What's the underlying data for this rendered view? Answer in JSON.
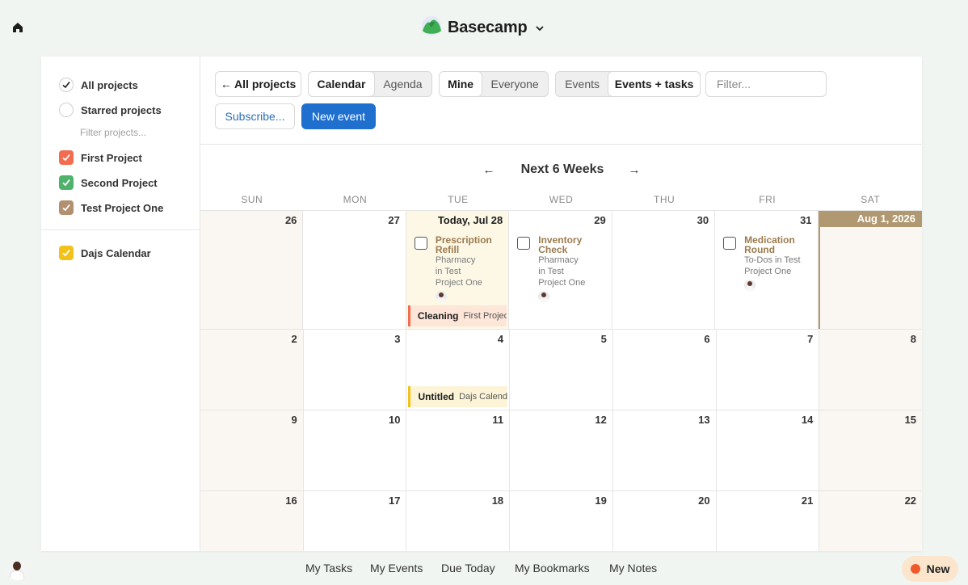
{
  "header": {
    "brand": "Basecamp"
  },
  "sidebar": {
    "items": [
      {
        "label": "All projects",
        "type": "radio",
        "checked": true
      },
      {
        "label": "Starred projects",
        "type": "radio",
        "checked": false
      }
    ],
    "filter_placeholder": "Filter projects...",
    "projects": [
      {
        "label": "First Project",
        "color": "#f26c4f",
        "checked": true
      },
      {
        "label": "Second Project",
        "color": "#4fb26c",
        "checked": true
      },
      {
        "label": "Test Project One",
        "color": "#b29070",
        "checked": true
      }
    ],
    "calendars": [
      {
        "label": "Dajs Calendar",
        "color": "#f2c21a",
        "checked": true
      }
    ]
  },
  "toolbar": {
    "all_projects": "← All projects",
    "view": {
      "options": [
        "Calendar",
        "Agenda"
      ],
      "active": "Calendar"
    },
    "scope": {
      "options": [
        "Mine",
        "Everyone"
      ],
      "active": "Mine"
    },
    "kind": {
      "options": [
        "Events",
        "Events + tasks"
      ],
      "active": "Events + tasks"
    },
    "filter_placeholder": "Filter...",
    "subscribe": "Subscribe...",
    "new_event": "New event"
  },
  "nav": {
    "prev": "←",
    "title": "Next 6 Weeks",
    "next": "→"
  },
  "calendar": {
    "days_of_week": [
      "SUN",
      "MON",
      "TUE",
      "WED",
      "THU",
      "FRI",
      "SAT"
    ],
    "today_label": "Today, Jul 28",
    "weeks": [
      [
        "26",
        "27",
        "Today, Jul 28",
        "29",
        "30",
        "31",
        "Aug 1, 2026"
      ],
      [
        "2",
        "3",
        "4",
        "5",
        "6",
        "7",
        "8"
      ],
      [
        "9",
        "10",
        "11",
        "12",
        "13",
        "14",
        "15"
      ],
      [
        "16",
        "17",
        "18",
        "19",
        "20",
        "21",
        "22"
      ]
    ],
    "todos": [
      {
        "title_1": "Prescription",
        "title_2": "Refill",
        "sub_1": "Pharmacy",
        "sub_2": "in Test",
        "sub_3": "Project One"
      },
      {
        "title_1": "Inventory",
        "title_2": "Check",
        "sub_1": "Pharmacy",
        "sub_2": "in Test",
        "sub_3": "Project One"
      },
      {
        "title_1": "Medication",
        "title_2": "Round",
        "sub_1": "To-Dos in Test",
        "sub_2": "Project One"
      }
    ],
    "events": [
      {
        "title": "Cleaning",
        "project": "First Project",
        "color": "#f26c4f",
        "bg": "#fde5d8"
      },
      {
        "title": "Untitled",
        "project": "Dajs Calenda",
        "color": "#f2c21a",
        "bg": "#fdf4d8"
      }
    ]
  },
  "footer": {
    "links": [
      "My Tasks",
      "My Events",
      "Due Today",
      "My Bookmarks",
      "My Notes"
    ],
    "new_label": "New"
  }
}
